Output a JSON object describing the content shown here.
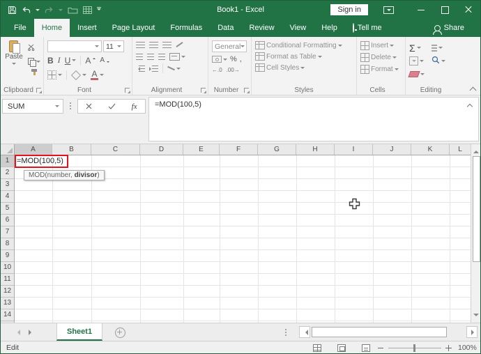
{
  "window": {
    "title": "Book1 - Excel",
    "sign_in_label": "Sign in"
  },
  "menu": {
    "file": "File",
    "home": "Home",
    "insert": "Insert",
    "page_layout": "Page Layout",
    "formulas": "Formulas",
    "data": "Data",
    "review": "Review",
    "view": "View",
    "help": "Help",
    "tell_me": "Tell me",
    "share": "Share"
  },
  "ribbon": {
    "paste_label": "Paste",
    "bold": "B",
    "italic": "I",
    "underline": "U",
    "grow_font": "A",
    "shrink_font": "A",
    "font_color": "A",
    "font_size": "11",
    "number_format": "General",
    "percent": "%",
    "comma": ",",
    "inc_decimal": "←.0",
    "dec_decimal": ".00→",
    "conditional_formatting": "Conditional Formatting",
    "format_as_table": "Format as Table",
    "cell_styles": "Cell Styles",
    "insert_label": "Insert",
    "delete_label": "Delete",
    "format_label": "Format",
    "autosum": "Σ",
    "groups": {
      "clipboard": "Clipboard",
      "font": "Font",
      "alignment": "Alignment",
      "number": "Number",
      "styles": "Styles",
      "cells": "Cells",
      "editing": "Editing"
    }
  },
  "formula_bar": {
    "name_box_value": "SUM",
    "formula": "=MOD(100,5)",
    "fx_label": "fx"
  },
  "grid": {
    "columns": [
      "A",
      "B",
      "C",
      "D",
      "E",
      "F",
      "G",
      "H",
      "I",
      "J",
      "K",
      "L"
    ],
    "rows": [
      "1",
      "2",
      "3",
      "4",
      "5",
      "6",
      "7",
      "8",
      "9",
      "10",
      "11",
      "12",
      "13",
      "14"
    ],
    "cell_a1_value": "=MOD(100,5)",
    "tooltip": {
      "prefix": "MOD(number, ",
      "bold": "divisor",
      "suffix": ")"
    }
  },
  "sheet_bar": {
    "sheet_tab": "Sheet1"
  },
  "status_bar": {
    "mode": "Edit",
    "zoom_level": "100%"
  },
  "colors": {
    "excel_green": "#217346",
    "annotation_red": "#e0151b"
  }
}
